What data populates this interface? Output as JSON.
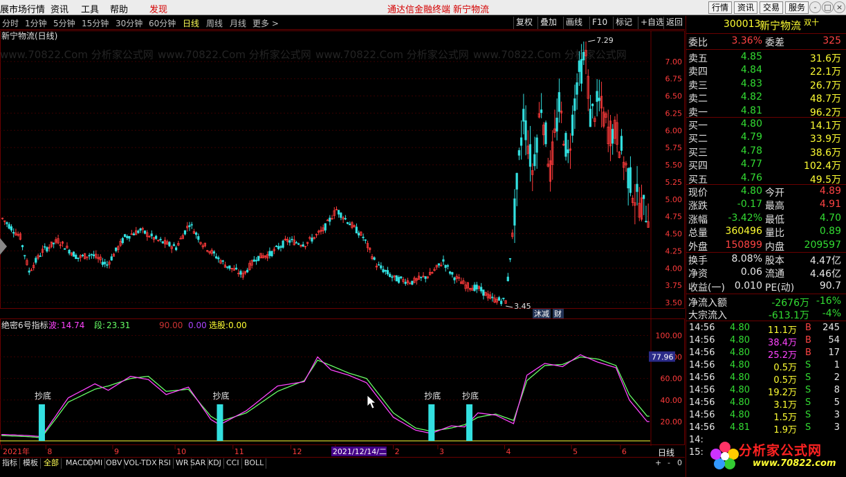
{
  "menubar": {
    "items": [
      "展市场行情",
      "资讯",
      "工具",
      "帮助",
      "发现"
    ],
    "center_title": "通达信金融终端",
    "center_stock": "新宁物流",
    "right_buttons": [
      "行情",
      "资讯",
      "交易",
      "服务"
    ],
    "win_controls": [
      "-",
      "□",
      "×"
    ]
  },
  "periodbar": {
    "periods": [
      "分时",
      "1分钟",
      "5分钟",
      "15分钟",
      "30分钟",
      "60分钟",
      "日线",
      "周线",
      "月线",
      "更多 >"
    ],
    "active_period": "日线",
    "tools": [
      "复权",
      "叠加",
      "画线",
      "F10",
      "标记",
      "+自选",
      "返回"
    ]
  },
  "chart_header": {
    "title": "新宁物流(日线)",
    "high_label": "7.29",
    "low_label": "3.45",
    "tags": [
      "沐减",
      "财"
    ]
  },
  "watermark": "www.70822.Com 分析家公式网",
  "chart_data": [
    {
      "type": "candlestick",
      "title": "新宁物流(日线)",
      "x_ticks": [
        "2021年",
        "8",
        "9",
        "10",
        "11",
        "12",
        "2021/12/14/二",
        "2",
        "3",
        "4",
        "5",
        "6"
      ],
      "y_ticks": [
        7.0,
        6.75,
        6.5,
        6.25,
        6.0,
        5.75,
        5.5,
        5.25,
        5.0,
        4.75,
        4.5,
        4.25,
        4.0,
        3.75,
        3.5
      ],
      "ylim": [
        3.45,
        7.35
      ],
      "annotations": [
        {
          "label": "7.29",
          "value": 7.29
        },
        {
          "label": "3.45",
          "value": 3.45
        }
      ],
      "anchors": [
        [
          0,
          4.72
        ],
        [
          8,
          4.45
        ],
        [
          12,
          3.95
        ],
        [
          18,
          4.25
        ],
        [
          25,
          4.4
        ],
        [
          34,
          4.15
        ],
        [
          40,
          4.2
        ],
        [
          47,
          4.05
        ],
        [
          55,
          4.45
        ],
        [
          62,
          4.55
        ],
        [
          70,
          4.4
        ],
        [
          78,
          4.3
        ],
        [
          84,
          4.65
        ],
        [
          90,
          4.35
        ],
        [
          100,
          4.05
        ],
        [
          108,
          3.9
        ],
        [
          114,
          4.15
        ],
        [
          120,
          4.2
        ],
        [
          128,
          4.4
        ],
        [
          136,
          4.35
        ],
        [
          144,
          4.55
        ],
        [
          150,
          4.85
        ],
        [
          156,
          4.65
        ],
        [
          162,
          4.45
        ],
        [
          168,
          4.05
        ],
        [
          176,
          3.85
        ],
        [
          184,
          3.8
        ],
        [
          192,
          3.9
        ],
        [
          198,
          4.1
        ],
        [
          202,
          3.9
        ],
        [
          208,
          3.75
        ],
        [
          214,
          3.7
        ],
        [
          220,
          3.55
        ],
        [
          226,
          3.52
        ],
        [
          230,
          4.8
        ],
        [
          234,
          6.25
        ],
        [
          238,
          5.4
        ],
        [
          242,
          6.4
        ],
        [
          246,
          5.4
        ],
        [
          250,
          6.35
        ],
        [
          254,
          5.6
        ],
        [
          258,
          6.7
        ],
        [
          262,
          7.1
        ],
        [
          264,
          6.2
        ],
        [
          268,
          6.4
        ],
        [
          272,
          6.0
        ],
        [
          276,
          5.95
        ],
        [
          280,
          5.45
        ],
        [
          284,
          5.05
        ],
        [
          288,
          4.85
        ],
        [
          290,
          4.8
        ]
      ]
    },
    {
      "type": "line",
      "title": "绝密6号指标",
      "legend": [
        {
          "name": "波",
          "value": "14.74"
        },
        {
          "name": "段",
          "value": "23.31"
        }
      ],
      "legend_extra": [
        "90.00",
        "0.00"
      ],
      "pick_label": "选股",
      "pick_value": "0.00",
      "y_ticks": [
        100.0,
        80.0,
        60.0,
        40.0,
        20.0
      ],
      "ylim": [
        0,
        108
      ],
      "current_value": "77.96",
      "signal_label": "抄底",
      "signals": [
        18,
        98,
        193,
        210
      ],
      "bo_anchors": [
        [
          0,
          8
        ],
        [
          12,
          7
        ],
        [
          18,
          6
        ],
        [
          30,
          42
        ],
        [
          42,
          55
        ],
        [
          48,
          49
        ],
        [
          58,
          62
        ],
        [
          66,
          59
        ],
        [
          74,
          45
        ],
        [
          84,
          52
        ],
        [
          94,
          22
        ],
        [
          98,
          17
        ],
        [
          110,
          30
        ],
        [
          124,
          53
        ],
        [
          136,
          57
        ],
        [
          142,
          80
        ],
        [
          148,
          68
        ],
        [
          156,
          63
        ],
        [
          164,
          56
        ],
        [
          176,
          24
        ],
        [
          186,
          12
        ],
        [
          193,
          9
        ],
        [
          202,
          16
        ],
        [
          208,
          15
        ],
        [
          214,
          28
        ],
        [
          222,
          26
        ],
        [
          230,
          18
        ],
        [
          236,
          63
        ],
        [
          244,
          74
        ],
        [
          252,
          71
        ],
        [
          260,
          82
        ],
        [
          268,
          75
        ],
        [
          276,
          70
        ],
        [
          282,
          40
        ],
        [
          290,
          20
        ]
      ],
      "duan_anchors": [
        [
          0,
          7
        ],
        [
          12,
          6
        ],
        [
          18,
          5
        ],
        [
          30,
          38
        ],
        [
          42,
          50
        ],
        [
          48,
          53
        ],
        [
          58,
          60
        ],
        [
          66,
          62
        ],
        [
          74,
          48
        ],
        [
          84,
          50
        ],
        [
          94,
          25
        ],
        [
          98,
          20
        ],
        [
          110,
          28
        ],
        [
          124,
          48
        ],
        [
          136,
          58
        ],
        [
          142,
          77
        ],
        [
          148,
          72
        ],
        [
          156,
          65
        ],
        [
          164,
          60
        ],
        [
          176,
          28
        ],
        [
          186,
          14
        ],
        [
          193,
          11
        ],
        [
          202,
          14
        ],
        [
          208,
          17
        ],
        [
          214,
          24
        ],
        [
          222,
          27
        ],
        [
          230,
          21
        ],
        [
          236,
          58
        ],
        [
          244,
          72
        ],
        [
          252,
          73
        ],
        [
          260,
          80
        ],
        [
          268,
          78
        ],
        [
          276,
          72
        ],
        [
          282,
          45
        ],
        [
          290,
          25
        ]
      ]
    }
  ],
  "panel": {
    "code": "300013",
    "name": "新宁物流",
    "badge": "双十",
    "weibi_label": "委比",
    "weibi_value": "3.36%",
    "weicha_label": "委差",
    "weicha_value": "325",
    "asks": [
      {
        "label": "卖五",
        "price": "4.85",
        "vol": "31.6万"
      },
      {
        "label": "卖四",
        "price": "4.84",
        "vol": "22.1万"
      },
      {
        "label": "卖三",
        "price": "4.83",
        "vol": "26.7万"
      },
      {
        "label": "卖二",
        "price": "4.82",
        "vol": "48.7万"
      },
      {
        "label": "卖一",
        "price": "4.81",
        "vol": "96.2万"
      }
    ],
    "bids": [
      {
        "label": "买一",
        "price": "4.80",
        "vol": "14.1万"
      },
      {
        "label": "买二",
        "price": "4.79",
        "vol": "33.9万"
      },
      {
        "label": "买三",
        "price": "4.78",
        "vol": "38.6万"
      },
      {
        "label": "买四",
        "price": "4.77",
        "vol": "102.4万"
      },
      {
        "label": "买五",
        "price": "4.76",
        "vol": "49.5万"
      }
    ],
    "stats": [
      {
        "l1": "现价",
        "v1": "4.80",
        "c1": "green",
        "l2": "今开",
        "v2": "4.89",
        "c2": "red"
      },
      {
        "l1": "涨跌",
        "v1": "-0.17",
        "c1": "green",
        "l2": "最高",
        "v2": "4.91",
        "c2": "red"
      },
      {
        "l1": "涨幅",
        "v1": "-3.42%",
        "c1": "green",
        "l2": "最低",
        "v2": "4.70",
        "c2": "green"
      },
      {
        "l1": "总量",
        "v1": "360496",
        "c1": "yellow",
        "l2": "量比",
        "v2": "0.89",
        "c2": "green"
      },
      {
        "l1": "外盘",
        "v1": "150899",
        "c1": "red",
        "l2": "内盘",
        "v2": "209597",
        "c2": "green"
      }
    ],
    "stats2": [
      {
        "l1": "换手",
        "v1": "8.08%",
        "c1": "white",
        "l2": "股本",
        "v2": "4.47亿",
        "c2": "white"
      },
      {
        "l1": "净资",
        "v1": "0.06",
        "c1": "white",
        "l2": "流通",
        "v2": "4.46亿",
        "c2": "white"
      },
      {
        "l1": "收益(一)",
        "v1": "0.010",
        "c1": "white",
        "l2": "PE(动)",
        "v2": "90.7",
        "c2": "white"
      }
    ],
    "flow": [
      {
        "label": "净流入额",
        "value": "-2676万",
        "pct": "-16%"
      },
      {
        "label": "大宗流入",
        "value": "-613.1万",
        "pct": "-4%"
      }
    ],
    "ticks": [
      {
        "time": "14:56",
        "price": "4.80",
        "vol": "11.1万",
        "vc": "yellow",
        "side": "B",
        "n": "245"
      },
      {
        "time": "14:56",
        "price": "4.80",
        "vol": "38.4万",
        "vc": "magenta",
        "side": "B",
        "n": "54"
      },
      {
        "time": "14:56",
        "price": "4.80",
        "vol": "25.2万",
        "vc": "magenta",
        "side": "B",
        "n": "17"
      },
      {
        "time": "14:56",
        "price": "4.80",
        "vol": "0.5万",
        "vc": "yellow",
        "side": "S",
        "n": "1"
      },
      {
        "time": "14:56",
        "price": "4.80",
        "vol": "0.5万",
        "vc": "yellow",
        "side": "S",
        "n": "2"
      },
      {
        "time": "14:56",
        "price": "4.80",
        "vol": "19.2万",
        "vc": "yellow",
        "side": "S",
        "n": "8"
      },
      {
        "time": "14:56",
        "price": "4.80",
        "vol": "3.1万",
        "vc": "yellow",
        "side": "S",
        "n": "5"
      },
      {
        "time": "14:56",
        "price": "4.80",
        "vol": "1.5万",
        "vc": "yellow",
        "side": "S",
        "n": "3"
      },
      {
        "time": "14:56",
        "price": "4.81",
        "vol": "1.9万",
        "vc": "yellow",
        "side": "S",
        "n": "3"
      }
    ],
    "tick_partial": [
      "14:",
      "15:"
    ]
  },
  "bottombar": {
    "tabs": [
      "指标",
      "模板",
      "全部",
      "MACD",
      "DMI",
      "OBV",
      "VOL-TDX",
      "RSI",
      "WR",
      "SAR",
      "KDJ",
      "CCI",
      "BOLL"
    ],
    "active_tab": "全部",
    "right_label": "日线",
    "zoom_in": "+",
    "zoom_out": "-",
    "zoom_value": "0"
  },
  "logo": {
    "title": "分析家公式网",
    "url": "www.70822.com"
  },
  "colors": {
    "up": "#ff3b3b",
    "down": "#33e0e0",
    "bo_line": "#ff44ff",
    "duan_line": "#66ff66",
    "grid": "#6b0000"
  }
}
